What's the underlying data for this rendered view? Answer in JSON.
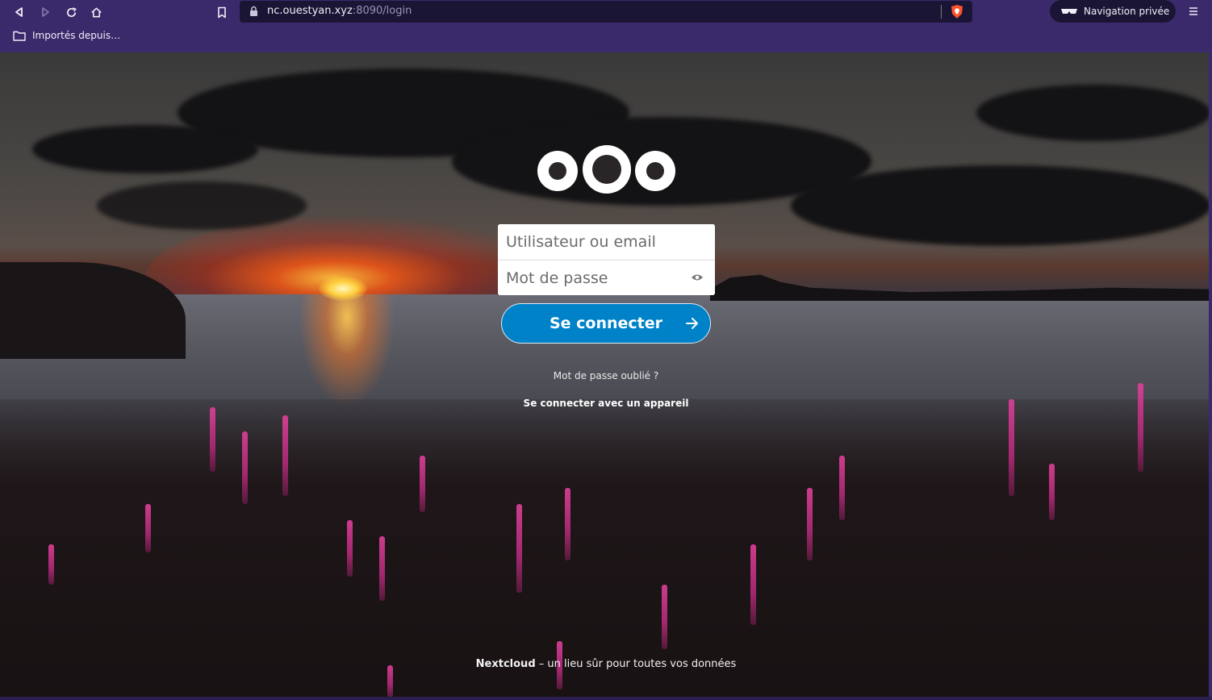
{
  "browser": {
    "url_host": "nc.ouestyan.xyz",
    "url_path": ":8090/login",
    "private_label": "Navigation privée",
    "bookmark_label": "Importés depuis…",
    "icons": [
      "back-icon",
      "forward-icon",
      "reload-icon",
      "home-icon",
      "bookmark-icon",
      "lock-icon",
      "brave-shields-icon",
      "private-mask-icon",
      "menu-icon",
      "folder-icon"
    ]
  },
  "login": {
    "username_placeholder": "Utilisateur ou email",
    "password_placeholder": "Mot de passe",
    "submit_label": "Se connecter",
    "forgot_label": "Mot de passe oublié ?",
    "device_label": "Se connecter avec un appareil"
  },
  "footer": {
    "brand": "Nextcloud",
    "tagline": " – un lieu sûr pour toutes vos données"
  },
  "colors": {
    "browser_bg": "#3b2a6b",
    "urlbar_bg": "#1b1535",
    "primary": "#0082c9"
  }
}
